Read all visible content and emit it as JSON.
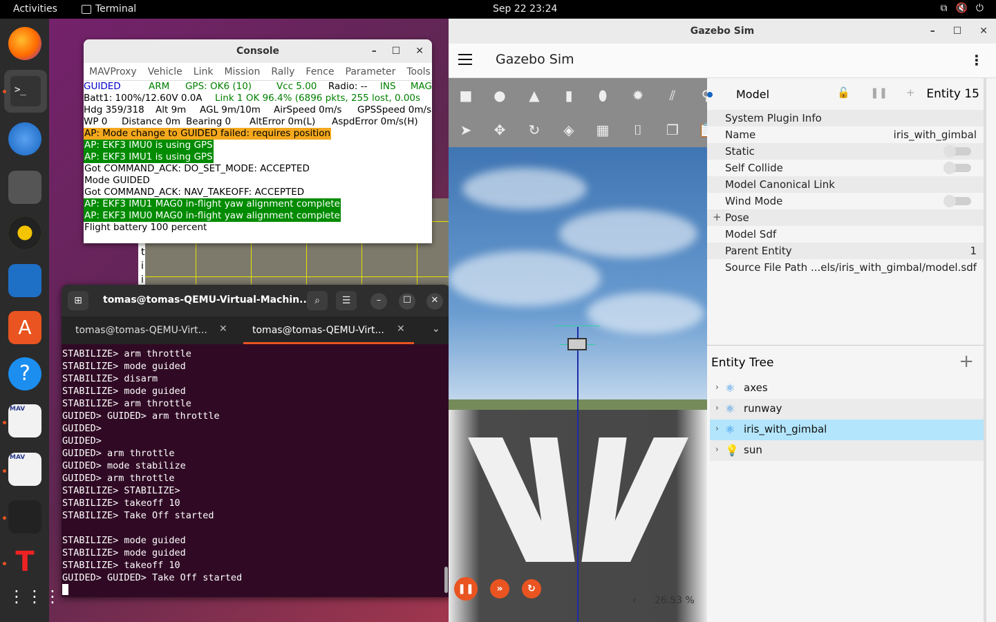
{
  "topbar": {
    "activities": "Activities",
    "app_name": "Terminal",
    "clock": "Sep 22  23:24"
  },
  "console": {
    "title": "Console",
    "menu": [
      "MAVProxy",
      "Vehicle",
      "Link",
      "Mission",
      "Rally",
      "Fence",
      "Parameter",
      "Tools"
    ],
    "status": {
      "row1": [
        "GUIDED",
        "ARM",
        "GPS: OK6 (10)",
        "Vcc 5.00",
        "Radio: --",
        "INS",
        "MAG"
      ],
      "row2": [
        "Batt1: 100%/12.60V 0.0A",
        "Link 1 OK 96.4% (6896 pkts, 255 lost, 0.00s"
      ],
      "row3": [
        "Hdg 359/318",
        "Alt 9m",
        "AGL 9m/10m",
        "AirSpeed 0m/s",
        "GPSSpeed 0m/s"
      ],
      "row4": [
        "WP 0",
        "Distance 0m",
        "Bearing 0",
        "AltError 0m(L)",
        "AspdError 0m/s(H)"
      ]
    },
    "log": [
      {
        "text": "AP: Mode change to GUIDED failed: requires position",
        "style": "orange"
      },
      {
        "text": "AP: EKF3 IMU0 is using GPS",
        "style": "green"
      },
      {
        "text": "AP: EKF3 IMU1 is using GPS",
        "style": "green"
      },
      {
        "text": "Got COMMAND_ACK: DO_SET_MODE: ACCEPTED",
        "style": "plain"
      },
      {
        "text": "Mode GUIDED",
        "style": "plain"
      },
      {
        "text": "Got COMMAND_ACK: NAV_TAKEOFF: ACCEPTED",
        "style": "plain"
      },
      {
        "text": "AP: EKF3 IMU1 MAG0 in-flight yaw alignment complete",
        "style": "green"
      },
      {
        "text": "AP: EKF3 IMU0 MAG0 in-flight yaw alignment complete",
        "style": "green"
      },
      {
        "text": "Flight battery 100 percent",
        "style": "plain"
      }
    ]
  },
  "mapwin": {
    "letters": [
      "t",
      "i",
      "i"
    ]
  },
  "terminal": {
    "title": "tomas@tomas-QEMU-Virtual-Machin...",
    "tabs": [
      "tomas@tomas-QEMU-Virt...",
      "tomas@tomas-QEMU-Virt..."
    ],
    "lines": [
      "STABILIZE> arm throttle",
      "STABILIZE> mode guided",
      "STABILIZE> disarm",
      "STABILIZE> mode guided",
      "STABILIZE> arm throttle",
      "GUIDED> GUIDED> arm throttle",
      "GUIDED>",
      "GUIDED>",
      "GUIDED> arm throttle",
      "GUIDED> mode stabilize",
      "GUIDED> arm throttle",
      "STABILIZE> STABILIZE>",
      "STABILIZE> takeoff 10",
      "STABILIZE> Take Off started",
      "",
      "STABILIZE> mode guided",
      "STABILIZE> mode guided",
      "STABILIZE> takeoff 10",
      "GUIDED> GUIDED> Take Off started"
    ]
  },
  "gazebo": {
    "window_title": "Gazebo Sim",
    "app_title": "Gazebo Sim",
    "rtf": "26.53 %",
    "component": {
      "header_label": "Model",
      "entity": "Entity 15",
      "rows": [
        {
          "label": "System Plugin Info",
          "value": "",
          "kind": "text"
        },
        {
          "label": "Name",
          "value": "iris_with_gimbal",
          "kind": "text"
        },
        {
          "label": "Static",
          "value": "",
          "kind": "toggle"
        },
        {
          "label": "Self Collide",
          "value": "",
          "kind": "toggle"
        },
        {
          "label": "Model Canonical Link",
          "value": "",
          "kind": "text"
        },
        {
          "label": "Wind Mode",
          "value": "",
          "kind": "toggle"
        },
        {
          "label": "Pose",
          "value": "",
          "kind": "expand"
        },
        {
          "label": "Model Sdf",
          "value": "",
          "kind": "text"
        },
        {
          "label": "Parent Entity",
          "value": "1",
          "kind": "text"
        },
        {
          "label": "Source File Path",
          "value": "...els/iris_with_gimbal/model.sdf",
          "kind": "text"
        }
      ]
    },
    "entity_tree": {
      "title": "Entity Tree",
      "items": [
        {
          "name": "axes",
          "icon": "model-icon"
        },
        {
          "name": "runway",
          "icon": "model-icon"
        },
        {
          "name": "iris_with_gimbal",
          "icon": "model-icon"
        },
        {
          "name": "sun",
          "icon": "light-icon"
        }
      ]
    }
  }
}
